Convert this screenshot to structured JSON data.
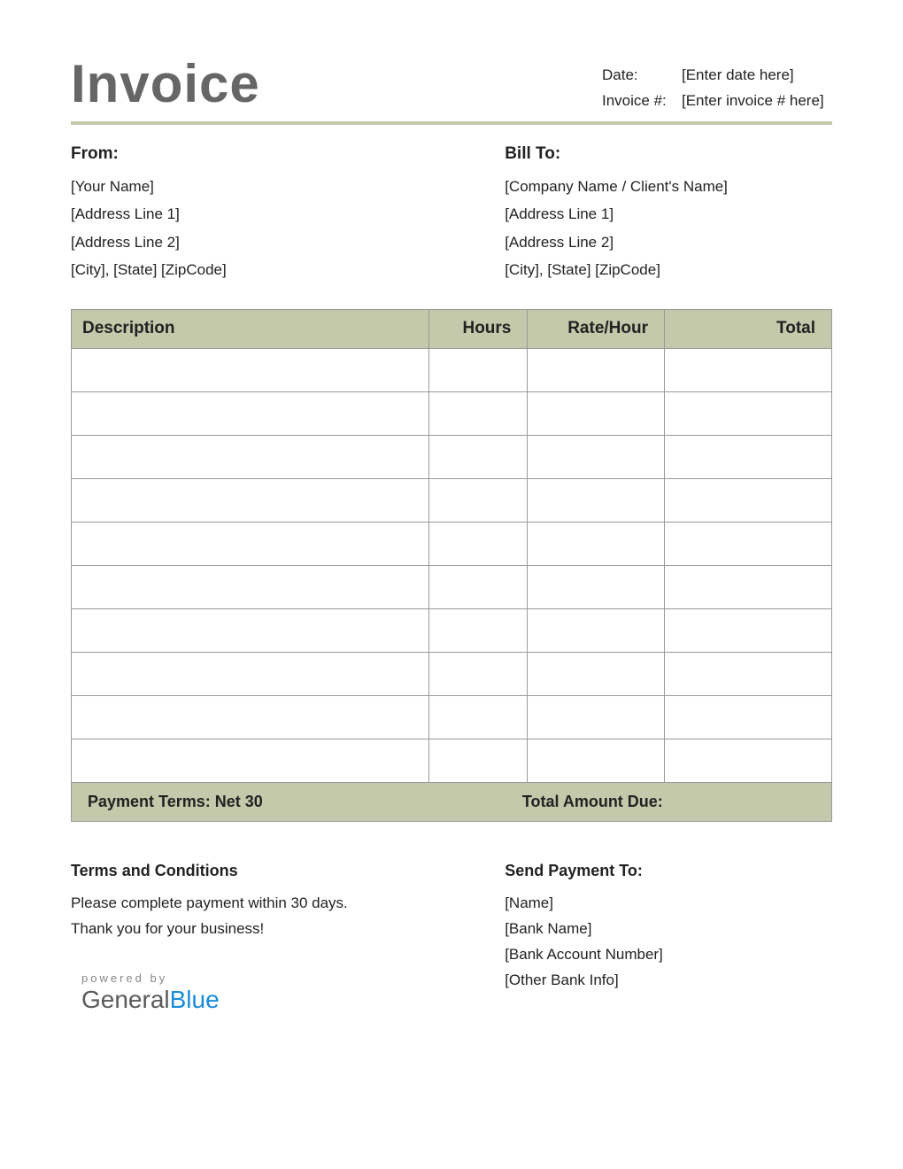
{
  "title": "Invoice",
  "meta": {
    "date_label": "Date:",
    "date_value": "[Enter date here]",
    "number_label": "Invoice #:",
    "number_value": "[Enter invoice # here]"
  },
  "from": {
    "heading": "From:",
    "name": "[Your Name]",
    "addr1": "[Address Line 1]",
    "addr2": "[Address Line 2]",
    "city": "[City], [State] [ZipCode]"
  },
  "bill_to": {
    "heading": "Bill To:",
    "name": "[Company Name / Client's Name]",
    "addr1": "[Address Line 1]",
    "addr2": "[Address Line 2]",
    "city": "[City], [State] [ZipCode]"
  },
  "columns": {
    "desc": "Description",
    "hours": "Hours",
    "rate": "Rate/Hour",
    "total": "Total"
  },
  "items": [
    {
      "desc": "",
      "hours": "",
      "rate": "",
      "total": ""
    },
    {
      "desc": "",
      "hours": "",
      "rate": "",
      "total": ""
    },
    {
      "desc": "",
      "hours": "",
      "rate": "",
      "total": ""
    },
    {
      "desc": "",
      "hours": "",
      "rate": "",
      "total": ""
    },
    {
      "desc": "",
      "hours": "",
      "rate": "",
      "total": ""
    },
    {
      "desc": "",
      "hours": "",
      "rate": "",
      "total": ""
    },
    {
      "desc": "",
      "hours": "",
      "rate": "",
      "total": ""
    },
    {
      "desc": "",
      "hours": "",
      "rate": "",
      "total": ""
    },
    {
      "desc": "",
      "hours": "",
      "rate": "",
      "total": ""
    },
    {
      "desc": "",
      "hours": "",
      "rate": "",
      "total": ""
    }
  ],
  "footer": {
    "payment_terms": "Payment Terms: Net 30",
    "total_due_label": "Total Amount Due:",
    "total_due_value": ""
  },
  "terms": {
    "heading": "Terms and Conditions",
    "line1": "Please complete payment within 30 days.",
    "line2": "Thank you for your business!"
  },
  "send_payment": {
    "heading": "Send Payment To:",
    "name": "[Name]",
    "bank": "[Bank Name]",
    "account": "[Bank Account Number]",
    "other": "[Other Bank Info]"
  },
  "powered": {
    "small": "powered by",
    "brand1": "General",
    "brand2": "Blue"
  }
}
